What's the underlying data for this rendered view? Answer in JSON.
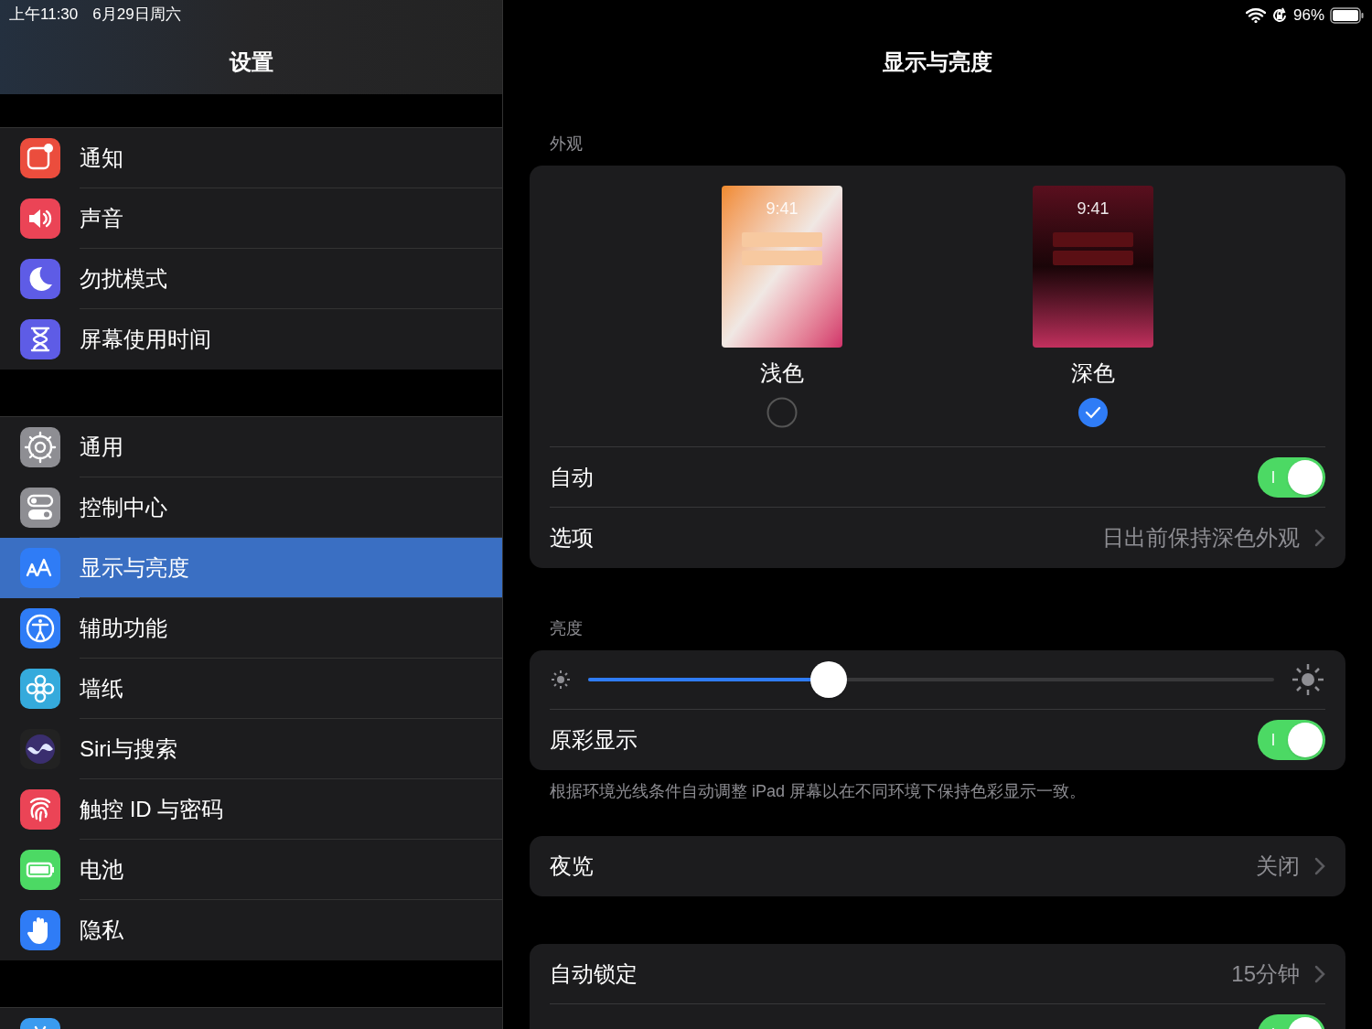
{
  "status_bar": {
    "time": "上午11:30",
    "date": "6月29日周六",
    "battery_text": "96%"
  },
  "sidebar": {
    "title": "设置",
    "groups": [
      [
        {
          "label": "通知",
          "color": "#eb4d3d",
          "selected": false
        },
        {
          "label": "声音",
          "color": "#eb4456",
          "selected": false
        },
        {
          "label": "勿扰模式",
          "color": "#5e5ce6",
          "selected": false
        },
        {
          "label": "屏幕使用时间",
          "color": "#5e5ce6",
          "selected": false
        }
      ],
      [
        {
          "label": "通用",
          "color": "#8e8e93",
          "selected": false
        },
        {
          "label": "控制中心",
          "color": "#8e8e93",
          "selected": false
        },
        {
          "label": "显示与亮度",
          "color": "#2f7cf6",
          "selected": true
        },
        {
          "label": "辅助功能",
          "color": "#2f7cf6",
          "selected": false
        },
        {
          "label": "墙纸",
          "color": "#35aadc",
          "selected": false
        },
        {
          "label": "Siri与搜索",
          "color": "#222222",
          "selected": false
        },
        {
          "label": "触控 ID 与密码",
          "color": "#eb4456",
          "selected": false
        },
        {
          "label": "电池",
          "color": "#4cd964",
          "selected": false
        },
        {
          "label": "隐私",
          "color": "#2f7cf6",
          "selected": false
        }
      ],
      [
        {
          "color": "#3a9bf0",
          "selected": false
        }
      ]
    ]
  },
  "detail": {
    "title": "显示与亮度",
    "appearance": {
      "header": "外观",
      "options": [
        {
          "label": "浅色",
          "time": "9:41",
          "kind": "light",
          "selected": false
        },
        {
          "label": "深色",
          "time": "9:41",
          "kind": "dark",
          "selected": true
        }
      ],
      "rows": [
        {
          "kind": "toggle",
          "label": "自动",
          "on": true
        },
        {
          "kind": "link",
          "label": "选项",
          "value": "日出前保持深色外观"
        }
      ]
    },
    "brightness": {
      "header": "亮度",
      "level": 0.35,
      "true_tone": {
        "label": "原彩显示",
        "on": true
      },
      "footer": "根据环境光线条件自动调整 iPad 屏幕以在不同环境下保持色彩显示一致。"
    },
    "night_shift": {
      "label": "夜览",
      "value": "关闭"
    },
    "lock_group": [
      {
        "kind": "link",
        "label": "自动锁定",
        "value": "15分钟"
      },
      {
        "kind": "toggle",
        "on": true
      }
    ]
  }
}
